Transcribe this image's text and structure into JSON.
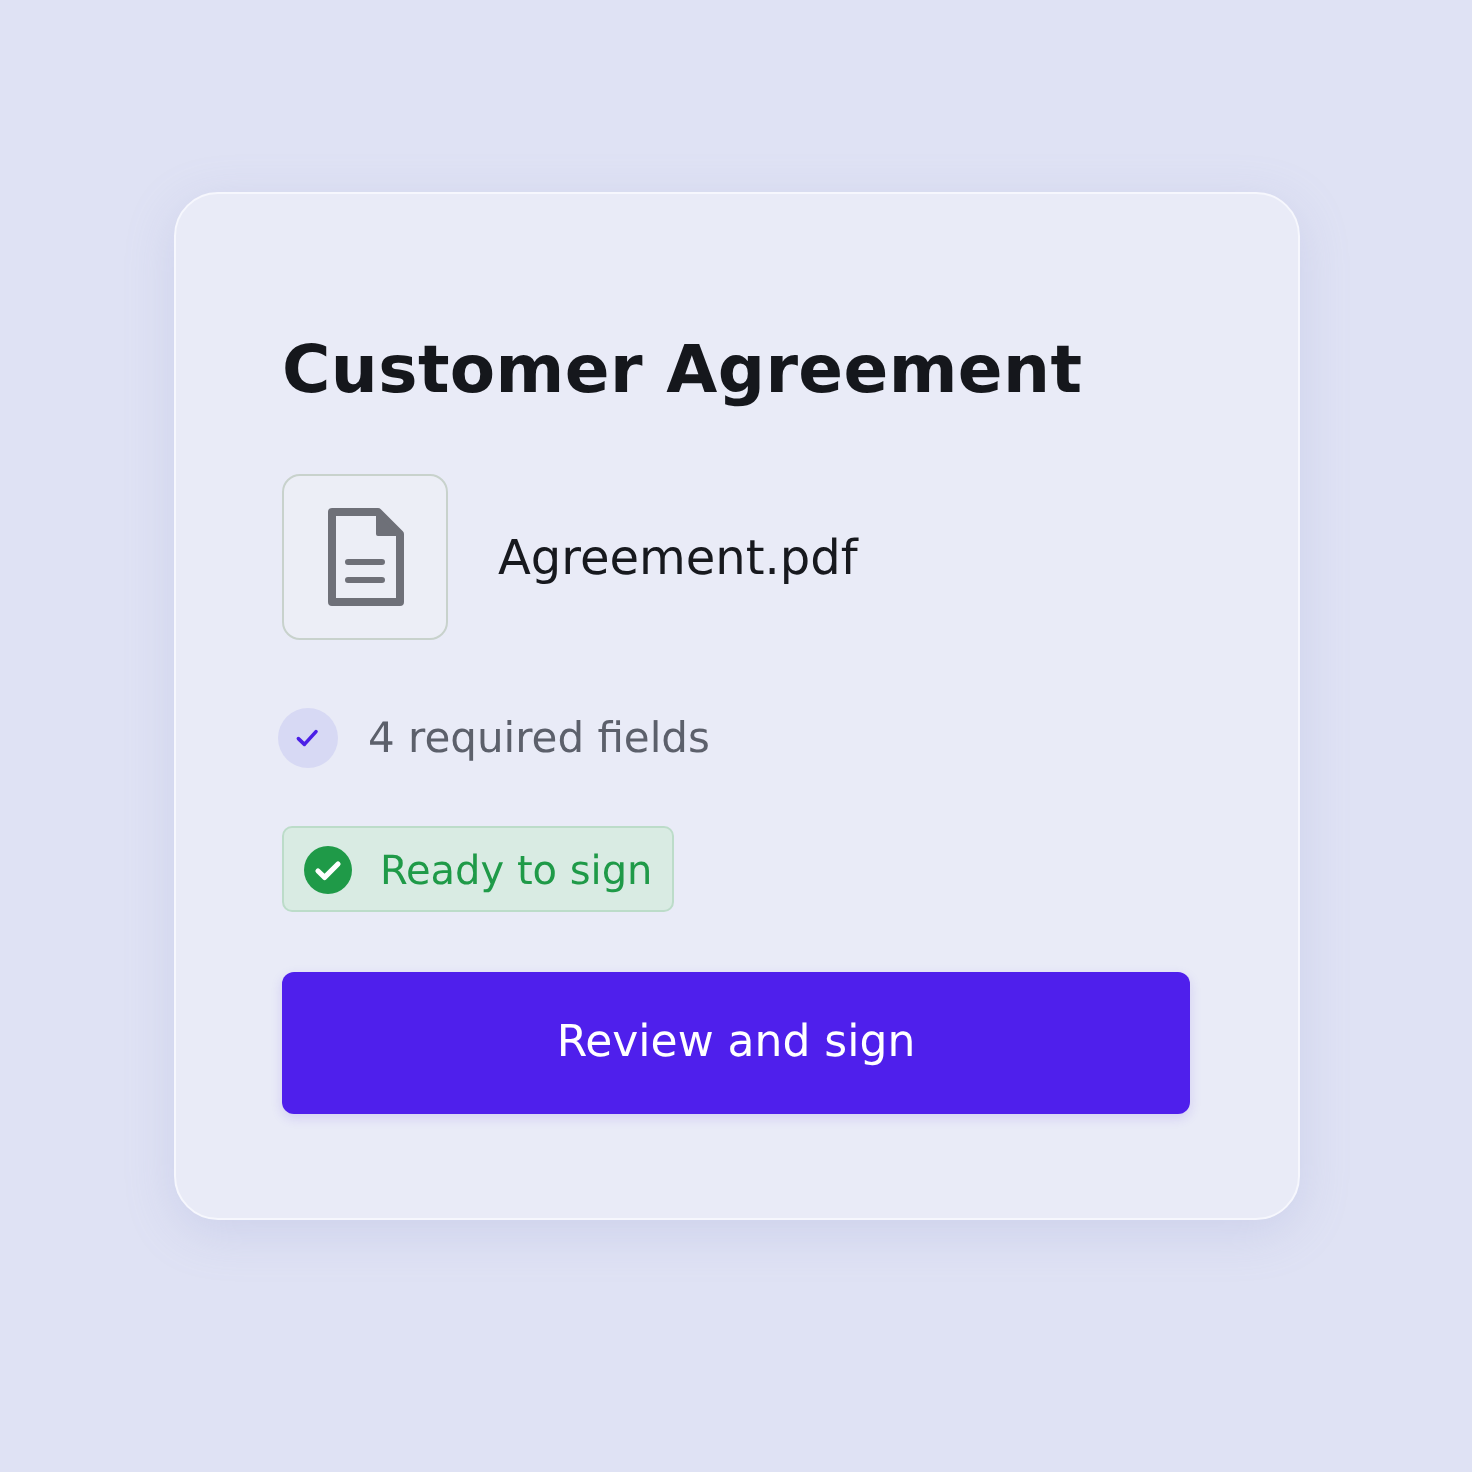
{
  "card": {
    "title": "Customer Agreement",
    "file": {
      "name": "Agreement.pdf"
    },
    "requirements": {
      "label": "4 required fields",
      "checked": true
    },
    "status": {
      "label": "Ready to sign",
      "kind": "success"
    },
    "button": {
      "label": "Review and sign"
    }
  }
}
